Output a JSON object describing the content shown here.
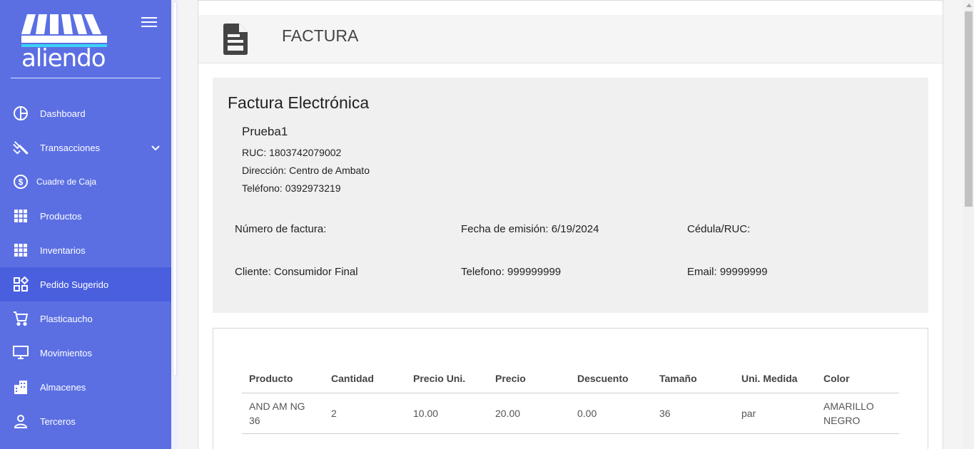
{
  "sidebar": {
    "logo_text": "aliendo",
    "items": [
      {
        "label": "Dashboard",
        "icon": "pie-chart-icon"
      },
      {
        "label": "Transacciones",
        "icon": "transactions-icon"
      },
      {
        "label": "Cuadre de Caja",
        "icon": "dollar-circle-icon"
      },
      {
        "label": "Productos",
        "icon": "grid-icon"
      },
      {
        "label": "Inventarios",
        "icon": "grid-icon"
      },
      {
        "label": "Pedido Sugerido",
        "icon": "widgets-icon"
      },
      {
        "label": "Plasticaucho",
        "icon": "cart-icon"
      },
      {
        "label": "Movimientos",
        "icon": "monitor-icon"
      },
      {
        "label": "Almacenes",
        "icon": "buildings-icon"
      },
      {
        "label": "Terceros",
        "icon": "person-icon"
      }
    ],
    "active_item": "Pedido Sugerido",
    "colors": {
      "background": "#5b6fe3",
      "active": "#4a5fdd"
    }
  },
  "header": {
    "title": "FACTURA",
    "icon": "document-icon"
  },
  "invoice": {
    "title": "Factura Electrónica",
    "company": {
      "name": "Prueba1",
      "ruc": "RUC: 1803742079002",
      "address": "Dirección: Centro de Ambato",
      "phone": "Teléfono: 0392973219"
    },
    "fields": {
      "invoice_number": "Número de factura:",
      "issue_date": "Fecha de emisión: 6/19/2024",
      "id_ruc": "Cédula/RUC:",
      "client": "Cliente: Consumidor Final",
      "client_phone": "Telefono: 999999999",
      "email": "Email: 99999999"
    }
  },
  "table": {
    "headers": [
      "Producto",
      "Cantidad",
      "Precio Uni.",
      "Precio",
      "Descuento",
      "Tamaño",
      "Uni. Medida",
      "Color"
    ],
    "rows": [
      [
        "AND AM NG 36",
        "2",
        "10.00",
        "20.00",
        "0.00",
        "36",
        "par",
        "AMARILLO NEGRO"
      ]
    ]
  }
}
